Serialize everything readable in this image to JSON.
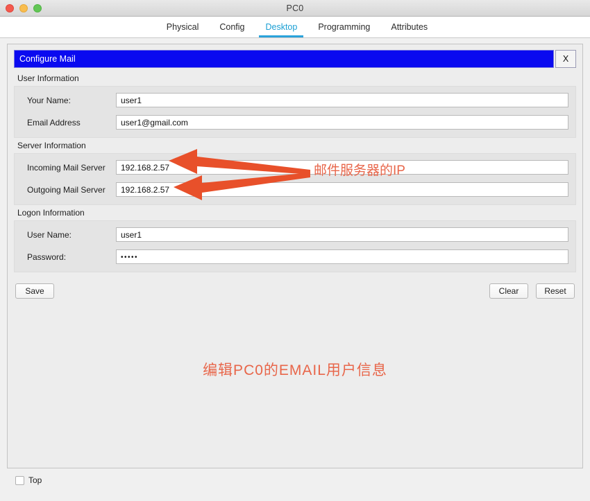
{
  "window": {
    "title": "PC0",
    "traffic_lights": [
      "close-red",
      "minimize-yellow",
      "maximize-green"
    ]
  },
  "tabs": [
    {
      "label": "Physical",
      "active": false
    },
    {
      "label": "Config",
      "active": false
    },
    {
      "label": "Desktop",
      "active": true
    },
    {
      "label": "Programming",
      "active": false
    },
    {
      "label": "Attributes",
      "active": false
    }
  ],
  "dialog": {
    "title": "Configure Mail",
    "close_label": "X",
    "title_bg": "#0a0af0"
  },
  "sections": {
    "user_information": {
      "legend": "User Information",
      "fields": [
        {
          "label": "Your Name:",
          "value": "user1"
        },
        {
          "label": "Email Address",
          "value": "user1@gmail.com"
        }
      ]
    },
    "server_information": {
      "legend": "Server Information",
      "fields": [
        {
          "label": "Incoming Mail Server",
          "value": "192.168.2.57"
        },
        {
          "label": "Outgoing Mail Server",
          "value": "192.168.2.57"
        }
      ]
    },
    "logon_information": {
      "legend": "Logon Information",
      "fields": [
        {
          "label": "User Name:",
          "value": "user1"
        },
        {
          "label": "Password:",
          "value": "•••••"
        }
      ]
    }
  },
  "buttons": {
    "save": "Save",
    "clear": "Clear",
    "reset": "Reset"
  },
  "annotations": {
    "color": "#e8664a",
    "ip_note": "邮件服务器的IP",
    "bottom_note": "编辑PC0的EMAIL用户信息"
  },
  "footer": {
    "top_checkbox_label": "Top",
    "top_checked": false
  }
}
